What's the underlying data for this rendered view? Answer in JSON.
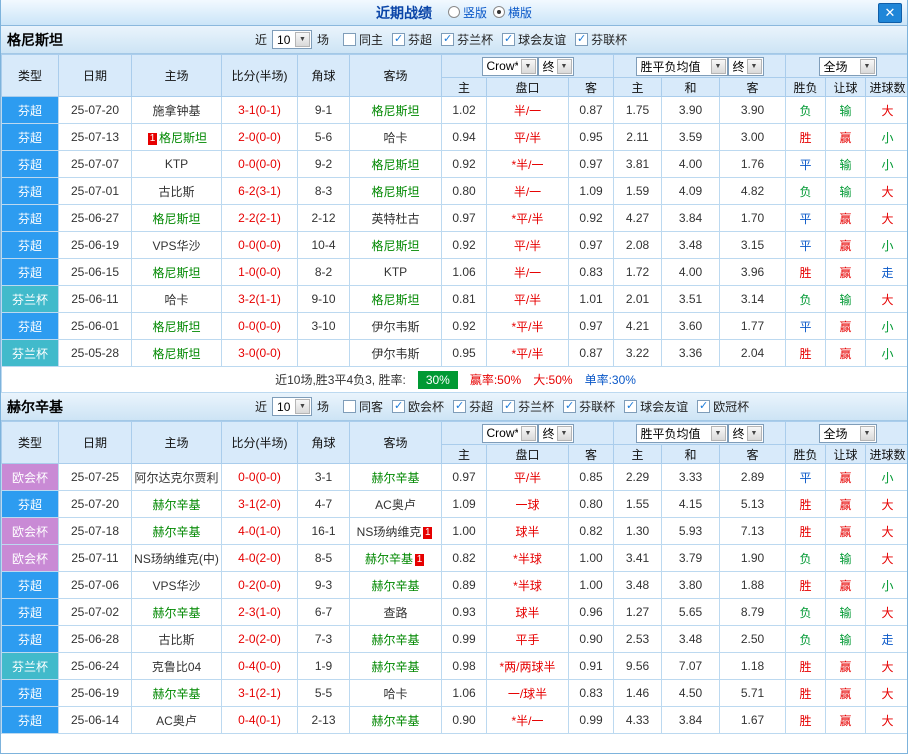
{
  "topbar": {
    "title": "近期战绩",
    "radios": [
      {
        "label": "竖版",
        "checked": false
      },
      {
        "label": "横版",
        "checked": true
      }
    ],
    "close_label": "✕"
  },
  "table_header": {
    "type": "类型",
    "date": "日期",
    "home": "主场",
    "score": "比分(半场)",
    "corner": "角球",
    "away": "客场",
    "odds_source": "Crow*",
    "odds_final": "终",
    "avg_source": "胜平负均值",
    "avg_final": "终",
    "scope": "全场",
    "odds_home": "主",
    "odds_line": "盘口",
    "odds_away": "客",
    "avg_home": "主",
    "avg_draw": "和",
    "avg_away": "客",
    "result": "胜负",
    "handicap": "让球",
    "goals": "进球数"
  },
  "colors": {
    "type": {
      "芬超": "#2d9cf0",
      "芬兰杯": "#41bacb",
      "欧会杯": "#c98ad5"
    },
    "value": {
      "胜": "#e60000",
      "平": "#0a58c8",
      "负": "#009933",
      "赢": "#e60000",
      "输": "#009933",
      "走": "#0a58c8",
      "大": "#e60000",
      "小": "#009933"
    },
    "focal_team": "#008800",
    "line_text": "#e60000",
    "score_text": "#e60000",
    "badge_bg": "#009933"
  },
  "sections": [
    {
      "team": "格尼斯坦",
      "near_prefix": "近",
      "match_count": "10",
      "near_suffix": "场",
      "filters": [
        {
          "label": "同主",
          "checked": false
        },
        {
          "label": "芬超",
          "checked": true
        },
        {
          "label": "芬兰杯",
          "checked": true
        },
        {
          "label": "球会友谊",
          "checked": true
        },
        {
          "label": "芬联杯",
          "checked": true
        }
      ],
      "rows": [
        {
          "type": "芬超",
          "date": "25-07-20",
          "home": "施拿钟基",
          "score": "3-1(0-1)",
          "corner": "9-1",
          "away": "格尼斯坦",
          "odds_home": "1.02",
          "line": "半/一",
          "odds_away": "0.87",
          "avg_home": "1.75",
          "avg_draw": "3.90",
          "avg_away": "3.90",
          "result": "负",
          "handicap": "输",
          "goals": "大"
        },
        {
          "type": "芬超",
          "date": "25-07-13",
          "home": "格尼斯坦",
          "home_card": "1",
          "home_card_side": "left",
          "score": "2-0(0-0)",
          "corner": "5-6",
          "away": "哈卡",
          "odds_home": "0.94",
          "line": "平/半",
          "odds_away": "0.95",
          "avg_home": "2.11",
          "avg_draw": "3.59",
          "avg_away": "3.00",
          "result": "胜",
          "handicap": "赢",
          "goals": "小"
        },
        {
          "type": "芬超",
          "date": "25-07-07",
          "home": "KTP",
          "score": "0-0(0-0)",
          "corner": "9-2",
          "away": "格尼斯坦",
          "odds_home": "0.92",
          "line": "*半/一",
          "odds_away": "0.97",
          "avg_home": "3.81",
          "avg_draw": "4.00",
          "avg_away": "1.76",
          "result": "平",
          "handicap": "输",
          "goals": "小"
        },
        {
          "type": "芬超",
          "date": "25-07-01",
          "home": "古比斯",
          "score": "6-2(3-1)",
          "corner": "8-3",
          "away": "格尼斯坦",
          "odds_home": "0.80",
          "line": "半/一",
          "odds_away": "1.09",
          "avg_home": "1.59",
          "avg_draw": "4.09",
          "avg_away": "4.82",
          "result": "负",
          "handicap": "输",
          "goals": "大"
        },
        {
          "type": "芬超",
          "date": "25-06-27",
          "home": "格尼斯坦",
          "score": "2-2(2-1)",
          "corner": "2-12",
          "away": "英特杜古",
          "odds_home": "0.97",
          "line": "*平/半",
          "odds_away": "0.92",
          "avg_home": "4.27",
          "avg_draw": "3.84",
          "avg_away": "1.70",
          "result": "平",
          "handicap": "赢",
          "goals": "大"
        },
        {
          "type": "芬超",
          "date": "25-06-19",
          "home": "VPS华沙",
          "score": "0-0(0-0)",
          "corner": "10-4",
          "away": "格尼斯坦",
          "odds_home": "0.92",
          "line": "平/半",
          "odds_away": "0.97",
          "avg_home": "2.08",
          "avg_draw": "3.48",
          "avg_away": "3.15",
          "result": "平",
          "handicap": "赢",
          "goals": "小"
        },
        {
          "type": "芬超",
          "date": "25-06-15",
          "home": "格尼斯坦",
          "score": "1-0(0-0)",
          "corner": "8-2",
          "away": "KTP",
          "odds_home": "1.06",
          "line": "半/一",
          "odds_away": "0.83",
          "avg_home": "1.72",
          "avg_draw": "4.00",
          "avg_away": "3.96",
          "result": "胜",
          "handicap": "赢",
          "goals": "走"
        },
        {
          "type": "芬兰杯",
          "date": "25-06-11",
          "home": "哈卡",
          "score": "3-2(1-1)",
          "corner": "9-10",
          "away": "格尼斯坦",
          "odds_home": "0.81",
          "line": "平/半",
          "odds_away": "1.01",
          "avg_home": "2.01",
          "avg_draw": "3.51",
          "avg_away": "3.14",
          "result": "负",
          "handicap": "输",
          "goals": "大"
        },
        {
          "type": "芬超",
          "date": "25-06-01",
          "home": "格尼斯坦",
          "score": "0-0(0-0)",
          "corner": "3-10",
          "away": "伊尔韦斯",
          "odds_home": "0.92",
          "line": "*平/半",
          "odds_away": "0.97",
          "avg_home": "4.21",
          "avg_draw": "3.60",
          "avg_away": "1.77",
          "result": "平",
          "handicap": "赢",
          "goals": "小"
        },
        {
          "type": "芬兰杯",
          "date": "25-05-28",
          "home": "格尼斯坦",
          "score": "3-0(0-0)",
          "corner": "",
          "away": "伊尔韦斯",
          "odds_home": "0.95",
          "line": "*平/半",
          "odds_away": "0.87",
          "avg_home": "3.22",
          "avg_draw": "3.36",
          "avg_away": "2.04",
          "result": "胜",
          "handicap": "赢",
          "goals": "小"
        }
      ],
      "summary": {
        "segments": [
          {
            "text": "近10场,胜3平4负3, 胜率:",
            "color": "#333333"
          },
          {
            "text": "30%",
            "badge": true
          },
          {
            "text": "赢率:50%",
            "color": "#e60000"
          },
          {
            "text": "大:50%",
            "color": "#e60000"
          },
          {
            "text": "单率:30%",
            "color": "#0a58c8"
          }
        ]
      }
    },
    {
      "team": "赫尔辛基",
      "near_prefix": "近",
      "match_count": "10",
      "near_suffix": "场",
      "filters": [
        {
          "label": "同客",
          "checked": false
        },
        {
          "label": "欧会杯",
          "checked": true
        },
        {
          "label": "芬超",
          "checked": true
        },
        {
          "label": "芬兰杯",
          "checked": true
        },
        {
          "label": "芬联杯",
          "checked": true
        },
        {
          "label": "球会友谊",
          "checked": true
        },
        {
          "label": "欧冠杯",
          "checked": true
        }
      ],
      "rows": [
        {
          "type": "欧会杯",
          "date": "25-07-25",
          "home": "阿尔达克尔贾利",
          "score": "0-0(0-0)",
          "corner": "3-1",
          "away": "赫尔辛基",
          "odds_home": "0.97",
          "line": "平/半",
          "odds_away": "0.85",
          "avg_home": "2.29",
          "avg_draw": "3.33",
          "avg_away": "2.89",
          "result": "平",
          "handicap": "赢",
          "goals": "小"
        },
        {
          "type": "芬超",
          "date": "25-07-20",
          "home": "赫尔辛基",
          "score": "3-1(2-0)",
          "corner": "4-7",
          "away": "AC奥卢",
          "odds_home": "1.09",
          "line": "一球",
          "odds_away": "0.80",
          "avg_home": "1.55",
          "avg_draw": "4.15",
          "avg_away": "5.13",
          "result": "胜",
          "handicap": "赢",
          "goals": "大"
        },
        {
          "type": "欧会杯",
          "date": "25-07-18",
          "home": "赫尔辛基",
          "score": "4-0(1-0)",
          "corner": "16-1",
          "away": "NS玚纳维克",
          "away_card": "1",
          "away_card_side": "right",
          "odds_home": "1.00",
          "line": "球半",
          "odds_away": "0.82",
          "avg_home": "1.30",
          "avg_draw": "5.93",
          "avg_away": "7.13",
          "result": "胜",
          "handicap": "赢",
          "goals": "大"
        },
        {
          "type": "欧会杯",
          "date": "25-07-11",
          "home": "NS玚纳维克(中)",
          "score": "4-0(2-0)",
          "corner": "8-5",
          "away": "赫尔辛基",
          "away_card": "1",
          "away_card_side": "right",
          "odds_home": "0.82",
          "line": "*半球",
          "odds_away": "1.00",
          "avg_home": "3.41",
          "avg_draw": "3.79",
          "avg_away": "1.90",
          "result": "负",
          "handicap": "输",
          "goals": "大"
        },
        {
          "type": "芬超",
          "date": "25-07-06",
          "home": "VPS华沙",
          "score": "0-2(0-0)",
          "corner": "9-3",
          "away": "赫尔辛基",
          "odds_home": "0.89",
          "line": "*半球",
          "odds_away": "1.00",
          "avg_home": "3.48",
          "avg_draw": "3.80",
          "avg_away": "1.88",
          "result": "胜",
          "handicap": "赢",
          "goals": "小"
        },
        {
          "type": "芬超",
          "date": "25-07-02",
          "home": "赫尔辛基",
          "score": "2-3(1-0)",
          "corner": "6-7",
          "away": "查路",
          "odds_home": "0.93",
          "line": "球半",
          "odds_away": "0.96",
          "avg_home": "1.27",
          "avg_draw": "5.65",
          "avg_away": "8.79",
          "result": "负",
          "handicap": "输",
          "goals": "大"
        },
        {
          "type": "芬超",
          "date": "25-06-28",
          "home": "古比斯",
          "score": "2-0(2-0)",
          "corner": "7-3",
          "away": "赫尔辛基",
          "odds_home": "0.99",
          "line": "平手",
          "odds_away": "0.90",
          "avg_home": "2.53",
          "avg_draw": "3.48",
          "avg_away": "2.50",
          "result": "负",
          "handicap": "输",
          "goals": "走"
        },
        {
          "type": "芬兰杯",
          "date": "25-06-24",
          "home": "克鲁比04",
          "score": "0-4(0-0)",
          "corner": "1-9",
          "away": "赫尔辛基",
          "odds_home": "0.98",
          "line": "*两/两球半",
          "odds_away": "0.91",
          "avg_home": "9.56",
          "avg_draw": "7.07",
          "avg_away": "1.18",
          "result": "胜",
          "handicap": "赢",
          "goals": "大"
        },
        {
          "type": "芬超",
          "date": "25-06-19",
          "home": "赫尔辛基",
          "score": "3-1(2-1)",
          "corner": "5-5",
          "away": "哈卡",
          "odds_home": "1.06",
          "line": "一/球半",
          "odds_away": "0.83",
          "avg_home": "1.46",
          "avg_draw": "4.50",
          "avg_away": "5.71",
          "result": "胜",
          "handicap": "赢",
          "goals": "大"
        },
        {
          "type": "芬超",
          "date": "25-06-14",
          "home": "AC奥卢",
          "score": "0-4(0-1)",
          "corner": "2-13",
          "away": "赫尔辛基",
          "odds_home": "0.90",
          "line": "*半/一",
          "odds_away": "0.99",
          "avg_home": "4.33",
          "avg_draw": "3.84",
          "avg_away": "1.67",
          "result": "胜",
          "handicap": "赢",
          "goals": "大"
        }
      ]
    }
  ]
}
